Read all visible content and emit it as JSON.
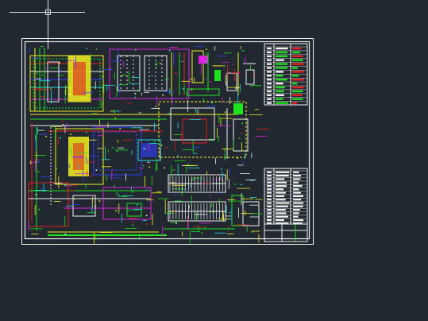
{
  "app": {
    "background_color": "#212830",
    "drawing_border_color": "#ffffff"
  },
  "crosshair": {
    "icon": "cad-crosshair-cursor-icon",
    "color": "#d8dde2"
  },
  "drawing": {
    "layer_colors": {
      "green": "#20e020",
      "yellow": "#f0f020",
      "magenta": "#e020e0",
      "blue": "#3040ff",
      "red": "#e02020",
      "cyan": "#20e0e0",
      "white": "#f0f0f0"
    }
  }
}
